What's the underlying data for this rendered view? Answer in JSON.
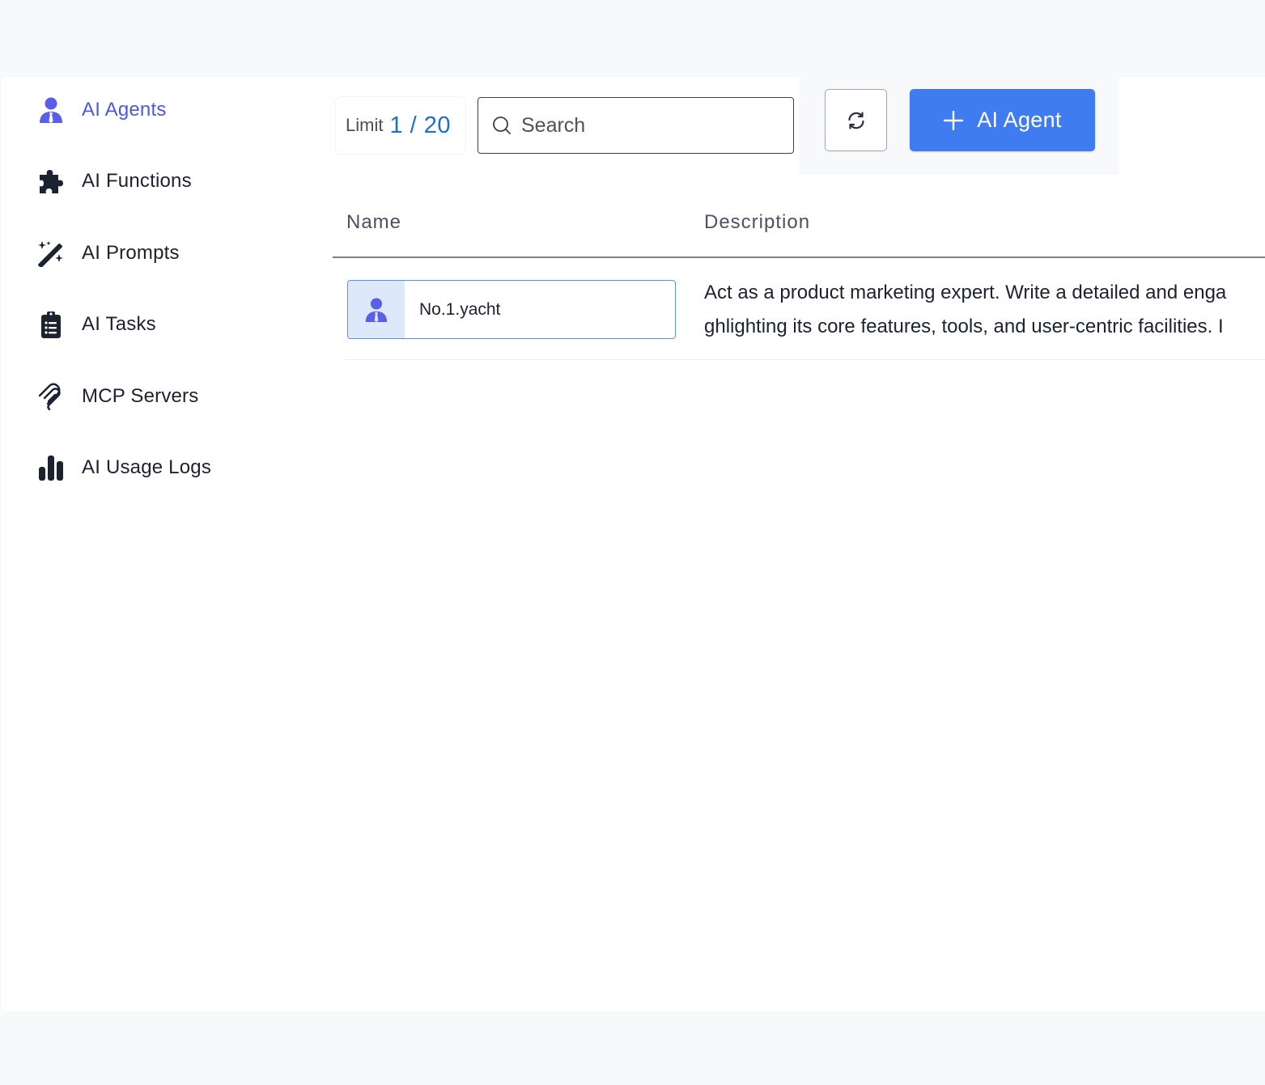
{
  "sidebar": {
    "items": [
      {
        "label": "AI Agents",
        "icon": "agent-icon",
        "active": true
      },
      {
        "label": "AI Functions",
        "icon": "puzzle-icon",
        "active": false
      },
      {
        "label": "AI Prompts",
        "icon": "magic-wand-icon",
        "active": false
      },
      {
        "label": "AI Tasks",
        "icon": "clipboard-list-icon",
        "active": false
      },
      {
        "label": "MCP Servers",
        "icon": "mcp-icon",
        "active": false
      },
      {
        "label": "AI Usage Logs",
        "icon": "bar-chart-icon",
        "active": false
      }
    ]
  },
  "toolbar": {
    "limit_label": "Limit",
    "limit_value": "1 / 20",
    "search_placeholder": "Search",
    "search_value": "",
    "add_button_label": "AI Agent"
  },
  "table": {
    "columns": [
      "Name",
      "Description"
    ],
    "rows": [
      {
        "name": "No.1.yacht",
        "description_line1": "Act as a product marketing expert. Write a detailed and enga",
        "description_line2": "ghlighting its core features, tools, and user-centric facilities. I"
      }
    ]
  },
  "colors": {
    "accent": "#3f7cf0",
    "active_nav": "#4c59d9",
    "limit_value": "#1c6fcf",
    "chip_bg": "#dde8fb"
  }
}
